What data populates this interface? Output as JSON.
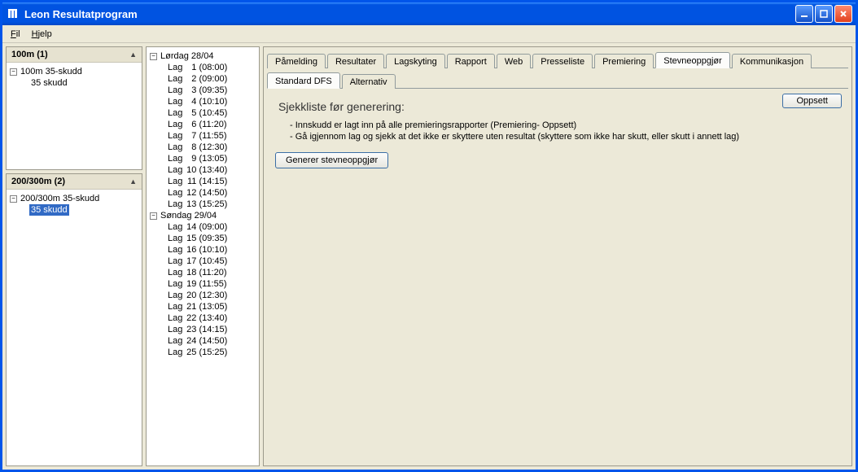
{
  "window": {
    "title": "Leon Resultatprogram"
  },
  "menubar": {
    "fil_u": "F",
    "fil_rest": "il",
    "hjelp_u": "H",
    "hjelp_rest": "jelp"
  },
  "left": {
    "box1": {
      "header": "100m (1)",
      "node1": "100m 35-skudd",
      "leaf1": "35 skudd"
    },
    "box2": {
      "header": "200/300m (2)",
      "node1": "200/300m 35-skudd",
      "leaf1": "35 skudd"
    }
  },
  "mid": {
    "days": [
      {
        "label": "Lørdag 28/04",
        "lags": [
          {
            "label": "Lag",
            "n": "1",
            "time": "(08:00)"
          },
          {
            "label": "Lag",
            "n": "2",
            "time": "(09:00)"
          },
          {
            "label": "Lag",
            "n": "3",
            "time": "(09:35)"
          },
          {
            "label": "Lag",
            "n": "4",
            "time": "(10:10)"
          },
          {
            "label": "Lag",
            "n": "5",
            "time": "(10:45)"
          },
          {
            "label": "Lag",
            "n": "6",
            "time": "(11:20)"
          },
          {
            "label": "Lag",
            "n": "7",
            "time": "(11:55)"
          },
          {
            "label": "Lag",
            "n": "8",
            "time": "(12:30)"
          },
          {
            "label": "Lag",
            "n": "9",
            "time": "(13:05)"
          },
          {
            "label": "Lag",
            "n": "10",
            "time": "(13:40)"
          },
          {
            "label": "Lag",
            "n": "11",
            "time": "(14:15)"
          },
          {
            "label": "Lag",
            "n": "12",
            "time": "(14:50)"
          },
          {
            "label": "Lag",
            "n": "13",
            "time": "(15:25)"
          }
        ]
      },
      {
        "label": "Søndag 29/04",
        "lags": [
          {
            "label": "Lag",
            "n": "14",
            "time": "(09:00)"
          },
          {
            "label": "Lag",
            "n": "15",
            "time": "(09:35)"
          },
          {
            "label": "Lag",
            "n": "16",
            "time": "(10:10)"
          },
          {
            "label": "Lag",
            "n": "17",
            "time": "(10:45)"
          },
          {
            "label": "Lag",
            "n": "18",
            "time": "(11:20)"
          },
          {
            "label": "Lag",
            "n": "19",
            "time": "(11:55)"
          },
          {
            "label": "Lag",
            "n": "20",
            "time": "(12:30)"
          },
          {
            "label": "Lag",
            "n": "21",
            "time": "(13:05)"
          },
          {
            "label": "Lag",
            "n": "22",
            "time": "(13:40)"
          },
          {
            "label": "Lag",
            "n": "23",
            "time": "(14:15)"
          },
          {
            "label": "Lag",
            "n": "24",
            "time": "(14:50)"
          },
          {
            "label": "Lag",
            "n": "25",
            "time": "(15:25)"
          }
        ]
      }
    ]
  },
  "tabs": {
    "primary": [
      {
        "label": "Påmelding",
        "active": false
      },
      {
        "label": "Resultater",
        "active": false
      },
      {
        "label": "Lagskyting",
        "active": false
      },
      {
        "label": "Rapport",
        "active": false
      },
      {
        "label": "Web",
        "active": false
      },
      {
        "label": "Presseliste",
        "active": false
      },
      {
        "label": "Premiering",
        "active": false
      },
      {
        "label": "Stevneoppgjør",
        "active": true
      },
      {
        "label": "Kommunikasjon",
        "active": false
      }
    ],
    "secondary": [
      {
        "label": "Standard DFS",
        "active": true
      },
      {
        "label": "Alternativ",
        "active": false
      }
    ]
  },
  "content": {
    "heading": "Sjekkliste før generering:",
    "items": [
      "- Innskudd er lagt inn på alle premieringsrapporter (Premiering- Oppsett)",
      "- Gå igjennom lag og sjekk at det ikke er skyttere uten resultat (skyttere som ikke har skutt, eller skutt i annett lag)"
    ],
    "generate_btn": "Generer stevneoppgjør",
    "oppsett_btn": "Oppsett"
  }
}
